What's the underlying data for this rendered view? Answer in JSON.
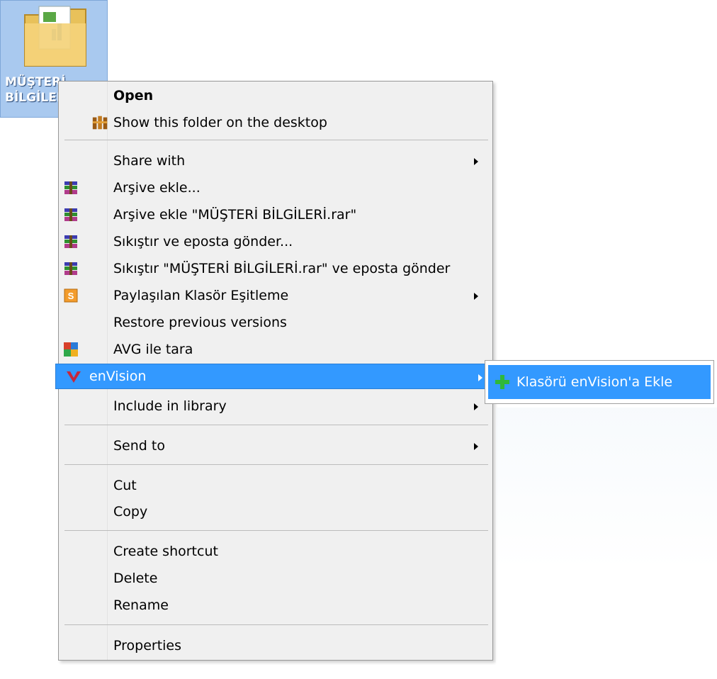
{
  "desktop": {
    "folder_label": "MÜŞTERİ\nBİLGİLERİ"
  },
  "menu": {
    "items": [
      {
        "label": "Open",
        "bold": true,
        "icon": ""
      },
      {
        "label": "Show this folder on the desktop",
        "icon": "desktop-folder-icon"
      },
      {
        "label": "Share with",
        "submenu": true
      },
      {
        "label": "Arşive ekle...",
        "icon": "winrar-icon"
      },
      {
        "label": "Arşive ekle \"MÜŞTERİ BİLGİLERİ.rar\"",
        "icon": "winrar-icon"
      },
      {
        "label": "Sıkıştır ve eposta gönder...",
        "icon": "winrar-icon"
      },
      {
        "label": "Sıkıştır \"MÜŞTERİ BİLGİLERİ.rar\" ve eposta gönder",
        "icon": "winrar-icon"
      },
      {
        "label": "Paylaşılan Klasör Eşitleme",
        "icon": "sync-s-icon",
        "submenu": true
      },
      {
        "label": "Restore previous versions"
      },
      {
        "label": "AVG ile tara",
        "icon": "avg-icon"
      },
      {
        "label": "enVision",
        "icon": "envision-icon",
        "submenu": true,
        "highlighted": true
      },
      {
        "label": "Include in library",
        "submenu": true
      },
      {
        "label": "Send to",
        "submenu": true
      },
      {
        "label": "Cut"
      },
      {
        "label": "Copy"
      },
      {
        "label": "Create shortcut"
      },
      {
        "label": "Delete"
      },
      {
        "label": "Rename"
      },
      {
        "label": "Properties"
      }
    ]
  },
  "submenu": {
    "items": [
      {
        "label": "Klasörü enVision'a Ekle",
        "icon": "plus-icon"
      }
    ]
  },
  "colors": {
    "highlight": "#3399ff",
    "menu_bg": "#f0f0f0"
  }
}
